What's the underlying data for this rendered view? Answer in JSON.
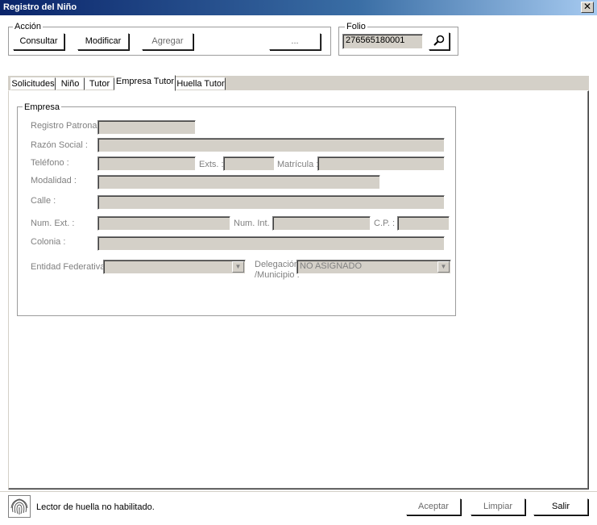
{
  "window": {
    "title": "Registro del Niño",
    "close_glyph": "✕"
  },
  "accion": {
    "legend": "Acción",
    "buttons": {
      "consultar": "Consultar",
      "modificar": "Modificar",
      "agregar": "Agregar",
      "more": "..."
    }
  },
  "folio": {
    "legend": "Folio",
    "value": "276565180001",
    "search_icon": "search-icon"
  },
  "tabs": [
    {
      "label": "Solicitudes"
    },
    {
      "label": "Niño"
    },
    {
      "label": "Tutor"
    },
    {
      "label": "Empresa Tutor",
      "active": true
    },
    {
      "label": "Huella Tutor"
    }
  ],
  "empresa": {
    "legend": "Empresa",
    "labels": {
      "registro_patronal": "Registro Patronal :",
      "razon_social": "Razón Social :",
      "telefono": "Teléfono :",
      "exts": "Exts. :",
      "matricula": "Matrícula :",
      "modalidad": "Modalidad :",
      "calle": "Calle :",
      "num_ext": "Num. Ext. :",
      "num_int": "Num. Int. :",
      "cp": "C.P. :",
      "colonia": "Colonia :",
      "entidad_federativa": "Entidad Federativa :",
      "delegacion_1": "Delegación",
      "delegacion_2": "/Municipio :"
    },
    "values": {
      "registro_patronal": "",
      "razon_social": "",
      "telefono": "",
      "exts": "",
      "matricula": "",
      "modalidad": "",
      "calle": "",
      "num_ext": "",
      "num_int": "",
      "cp": "",
      "colonia": "",
      "entidad_federativa": "",
      "delegacion": "NO ASIGNADO"
    }
  },
  "status": {
    "message": "Lector de huella no habilitado.",
    "icon": "fingerprint-icon"
  },
  "footer": {
    "aceptar": "Aceptar",
    "limpiar": "Limpiar",
    "salir": "Salir"
  }
}
